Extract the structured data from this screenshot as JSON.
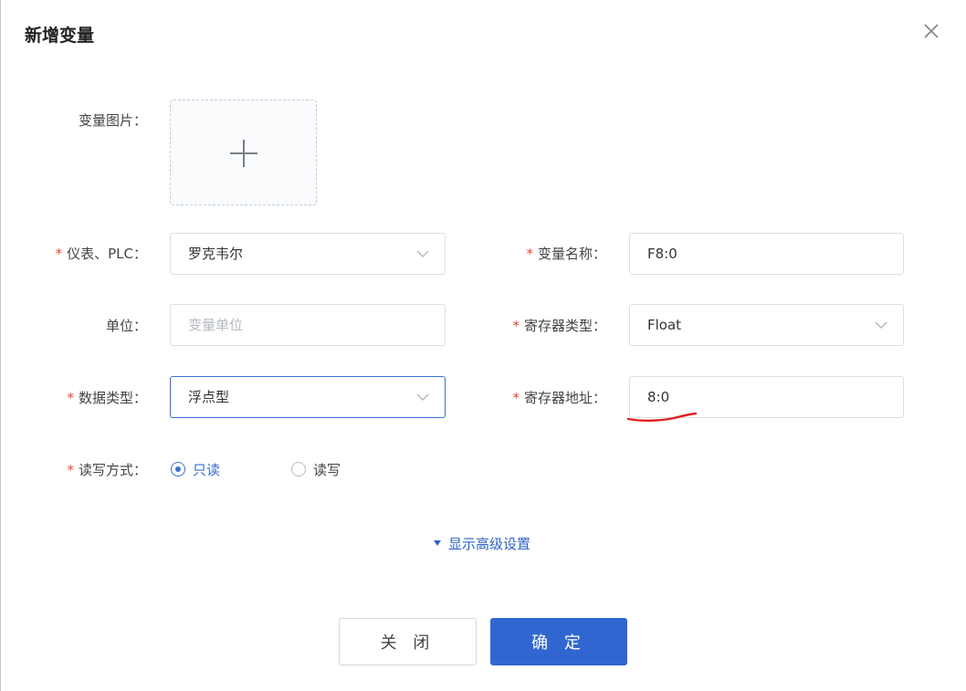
{
  "dialog": {
    "title": "新增变量",
    "close_icon": "close-icon"
  },
  "form": {
    "image": {
      "label": "变量图片：",
      "icon": "plus-icon"
    },
    "device": {
      "required": "*",
      "label": "仪表、PLC：",
      "value": "罗克韦尔"
    },
    "name": {
      "required": "*",
      "label": "变量名称：",
      "value": "F8:0"
    },
    "unit": {
      "label": "单位：",
      "value": "",
      "placeholder": "变量单位"
    },
    "register_type": {
      "required": "*",
      "label": "寄存器类型：",
      "value": "Float"
    },
    "data_type": {
      "required": "*",
      "label": "数据类型：",
      "value": "浮点型"
    },
    "register_address": {
      "required": "*",
      "label": "寄存器地址：",
      "value": "8:0"
    },
    "rw_mode": {
      "required": "*",
      "label": "读写方式：",
      "options": [
        "只读",
        "读写"
      ],
      "selected": "只读"
    },
    "advanced_toggle": "显示高级设置"
  },
  "footer": {
    "cancel_label": "关 闭",
    "ok_label": "确 定"
  },
  "colors": {
    "primary": "#3166d1",
    "required": "#e8483c",
    "annotation": "#e02020"
  }
}
